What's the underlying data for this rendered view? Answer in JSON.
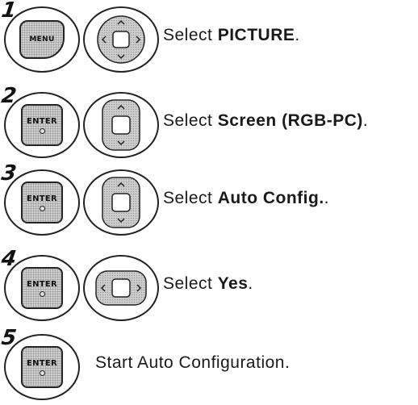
{
  "steps": [
    {
      "number": "1",
      "button": "MENU",
      "instruction_prefix": "Select ",
      "instruction_bold": "PICTURE",
      "instruction_suffix": ".",
      "nav_icon": "dpad-all-directions-icon"
    },
    {
      "number": "2",
      "button": "ENTER",
      "instruction_prefix": "Select ",
      "instruction_bold": "Screen (RGB-PC)",
      "instruction_suffix": ".",
      "nav_icon": "dpad-up-down-icon"
    },
    {
      "number": "3",
      "button": "ENTER",
      "instruction_prefix": "Select ",
      "instruction_bold": "Auto Config.",
      "instruction_suffix": ".",
      "nav_icon": "dpad-up-down-icon"
    },
    {
      "number": "4",
      "button": "ENTER",
      "instruction_prefix": "Select ",
      "instruction_bold": "Yes",
      "instruction_suffix": ".",
      "nav_icon": "dpad-left-right-icon"
    },
    {
      "number": "5",
      "button": "ENTER",
      "instruction": "Start Auto Configuration."
    }
  ]
}
